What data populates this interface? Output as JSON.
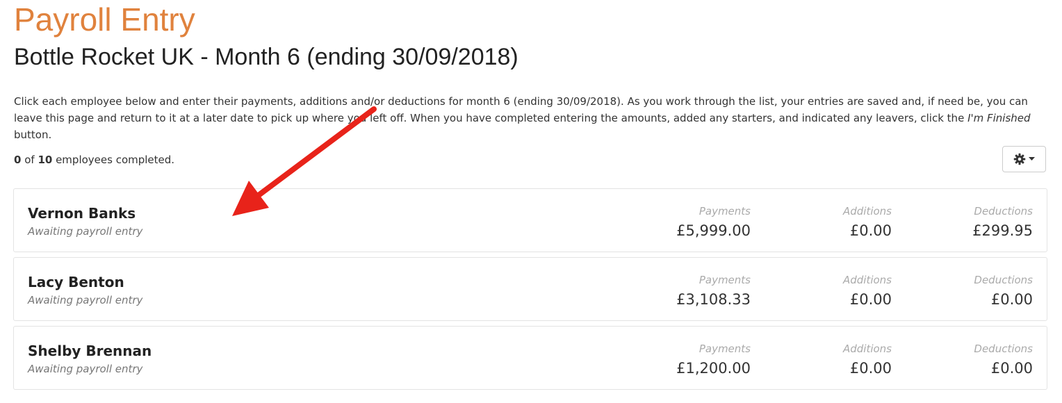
{
  "page": {
    "title": "Payroll Entry",
    "subtitle": "Bottle Rocket UK - Month 6 (ending 30/09/2018)"
  },
  "intro": {
    "text_before": "Click each employee below and enter their payments, additions and/or deductions for month 6 (ending 30/09/2018). As you work through the list, your entries are saved and, if need be, you can leave this page and return to it at a later date to pick up where you left off. When you have completed entering the amounts, added any starters, and indicated any leavers, click the ",
    "button_name": "I'm Finished",
    "text_after": " button."
  },
  "progress": {
    "completed": "0",
    "of_text": " of ",
    "total": "10",
    "suffix": " employees completed."
  },
  "settings_button": {
    "icon": "gear-icon",
    "caret": "caret-down-icon"
  },
  "employees": [
    {
      "name": "Vernon Banks",
      "status": "Awaiting payroll entry",
      "payments_label": "Payments",
      "payments": "£5,999.00",
      "additions_label": "Additions",
      "additions": "£0.00",
      "deductions_label": "Deductions",
      "deductions": "£299.95"
    },
    {
      "name": "Lacy Benton",
      "status": "Awaiting payroll entry",
      "payments_label": "Payments",
      "payments": "£3,108.33",
      "additions_label": "Additions",
      "additions": "£0.00",
      "deductions_label": "Deductions",
      "deductions": "£0.00"
    },
    {
      "name": "Shelby Brennan",
      "status": "Awaiting payroll entry",
      "payments_label": "Payments",
      "payments": "£1,200.00",
      "additions_label": "Additions",
      "additions": "£0.00",
      "deductions_label": "Deductions",
      "deductions": "£0.00"
    }
  ],
  "colors": {
    "title": "#e0823d",
    "annotation_arrow": "#e8231a",
    "muted_label": "#aaaaaa",
    "card_border": "#e3e3e3"
  }
}
